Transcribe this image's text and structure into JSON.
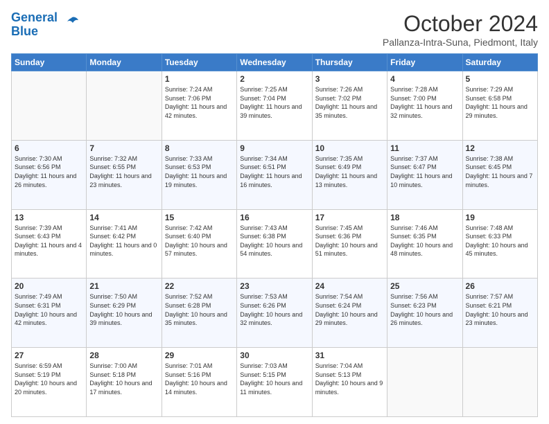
{
  "logo": {
    "line1": "General",
    "line2": "Blue"
  },
  "title": "October 2024",
  "location": "Pallanza-Intra-Suna, Piedmont, Italy",
  "days_of_week": [
    "Sunday",
    "Monday",
    "Tuesday",
    "Wednesday",
    "Thursday",
    "Friday",
    "Saturday"
  ],
  "weeks": [
    [
      {
        "day": null
      },
      {
        "day": null
      },
      {
        "day": 1,
        "sunrise": "Sunrise: 7:24 AM",
        "sunset": "Sunset: 7:06 PM",
        "daylight": "Daylight: 11 hours and 42 minutes."
      },
      {
        "day": 2,
        "sunrise": "Sunrise: 7:25 AM",
        "sunset": "Sunset: 7:04 PM",
        "daylight": "Daylight: 11 hours and 39 minutes."
      },
      {
        "day": 3,
        "sunrise": "Sunrise: 7:26 AM",
        "sunset": "Sunset: 7:02 PM",
        "daylight": "Daylight: 11 hours and 35 minutes."
      },
      {
        "day": 4,
        "sunrise": "Sunrise: 7:28 AM",
        "sunset": "Sunset: 7:00 PM",
        "daylight": "Daylight: 11 hours and 32 minutes."
      },
      {
        "day": 5,
        "sunrise": "Sunrise: 7:29 AM",
        "sunset": "Sunset: 6:58 PM",
        "daylight": "Daylight: 11 hours and 29 minutes."
      }
    ],
    [
      {
        "day": 6,
        "sunrise": "Sunrise: 7:30 AM",
        "sunset": "Sunset: 6:56 PM",
        "daylight": "Daylight: 11 hours and 26 minutes."
      },
      {
        "day": 7,
        "sunrise": "Sunrise: 7:32 AM",
        "sunset": "Sunset: 6:55 PM",
        "daylight": "Daylight: 11 hours and 23 minutes."
      },
      {
        "day": 8,
        "sunrise": "Sunrise: 7:33 AM",
        "sunset": "Sunset: 6:53 PM",
        "daylight": "Daylight: 11 hours and 19 minutes."
      },
      {
        "day": 9,
        "sunrise": "Sunrise: 7:34 AM",
        "sunset": "Sunset: 6:51 PM",
        "daylight": "Daylight: 11 hours and 16 minutes."
      },
      {
        "day": 10,
        "sunrise": "Sunrise: 7:35 AM",
        "sunset": "Sunset: 6:49 PM",
        "daylight": "Daylight: 11 hours and 13 minutes."
      },
      {
        "day": 11,
        "sunrise": "Sunrise: 7:37 AM",
        "sunset": "Sunset: 6:47 PM",
        "daylight": "Daylight: 11 hours and 10 minutes."
      },
      {
        "day": 12,
        "sunrise": "Sunrise: 7:38 AM",
        "sunset": "Sunset: 6:45 PM",
        "daylight": "Daylight: 11 hours and 7 minutes."
      }
    ],
    [
      {
        "day": 13,
        "sunrise": "Sunrise: 7:39 AM",
        "sunset": "Sunset: 6:43 PM",
        "daylight": "Daylight: 11 hours and 4 minutes."
      },
      {
        "day": 14,
        "sunrise": "Sunrise: 7:41 AM",
        "sunset": "Sunset: 6:42 PM",
        "daylight": "Daylight: 11 hours and 0 minutes."
      },
      {
        "day": 15,
        "sunrise": "Sunrise: 7:42 AM",
        "sunset": "Sunset: 6:40 PM",
        "daylight": "Daylight: 10 hours and 57 minutes."
      },
      {
        "day": 16,
        "sunrise": "Sunrise: 7:43 AM",
        "sunset": "Sunset: 6:38 PM",
        "daylight": "Daylight: 10 hours and 54 minutes."
      },
      {
        "day": 17,
        "sunrise": "Sunrise: 7:45 AM",
        "sunset": "Sunset: 6:36 PM",
        "daylight": "Daylight: 10 hours and 51 minutes."
      },
      {
        "day": 18,
        "sunrise": "Sunrise: 7:46 AM",
        "sunset": "Sunset: 6:35 PM",
        "daylight": "Daylight: 10 hours and 48 minutes."
      },
      {
        "day": 19,
        "sunrise": "Sunrise: 7:48 AM",
        "sunset": "Sunset: 6:33 PM",
        "daylight": "Daylight: 10 hours and 45 minutes."
      }
    ],
    [
      {
        "day": 20,
        "sunrise": "Sunrise: 7:49 AM",
        "sunset": "Sunset: 6:31 PM",
        "daylight": "Daylight: 10 hours and 42 minutes."
      },
      {
        "day": 21,
        "sunrise": "Sunrise: 7:50 AM",
        "sunset": "Sunset: 6:29 PM",
        "daylight": "Daylight: 10 hours and 39 minutes."
      },
      {
        "day": 22,
        "sunrise": "Sunrise: 7:52 AM",
        "sunset": "Sunset: 6:28 PM",
        "daylight": "Daylight: 10 hours and 35 minutes."
      },
      {
        "day": 23,
        "sunrise": "Sunrise: 7:53 AM",
        "sunset": "Sunset: 6:26 PM",
        "daylight": "Daylight: 10 hours and 32 minutes."
      },
      {
        "day": 24,
        "sunrise": "Sunrise: 7:54 AM",
        "sunset": "Sunset: 6:24 PM",
        "daylight": "Daylight: 10 hours and 29 minutes."
      },
      {
        "day": 25,
        "sunrise": "Sunrise: 7:56 AM",
        "sunset": "Sunset: 6:23 PM",
        "daylight": "Daylight: 10 hours and 26 minutes."
      },
      {
        "day": 26,
        "sunrise": "Sunrise: 7:57 AM",
        "sunset": "Sunset: 6:21 PM",
        "daylight": "Daylight: 10 hours and 23 minutes."
      }
    ],
    [
      {
        "day": 27,
        "sunrise": "Sunrise: 6:59 AM",
        "sunset": "Sunset: 5:19 PM",
        "daylight": "Daylight: 10 hours and 20 minutes."
      },
      {
        "day": 28,
        "sunrise": "Sunrise: 7:00 AM",
        "sunset": "Sunset: 5:18 PM",
        "daylight": "Daylight: 10 hours and 17 minutes."
      },
      {
        "day": 29,
        "sunrise": "Sunrise: 7:01 AM",
        "sunset": "Sunset: 5:16 PM",
        "daylight": "Daylight: 10 hours and 14 minutes."
      },
      {
        "day": 30,
        "sunrise": "Sunrise: 7:03 AM",
        "sunset": "Sunset: 5:15 PM",
        "daylight": "Daylight: 10 hours and 11 minutes."
      },
      {
        "day": 31,
        "sunrise": "Sunrise: 7:04 AM",
        "sunset": "Sunset: 5:13 PM",
        "daylight": "Daylight: 10 hours and 9 minutes."
      },
      {
        "day": null
      },
      {
        "day": null
      }
    ]
  ]
}
